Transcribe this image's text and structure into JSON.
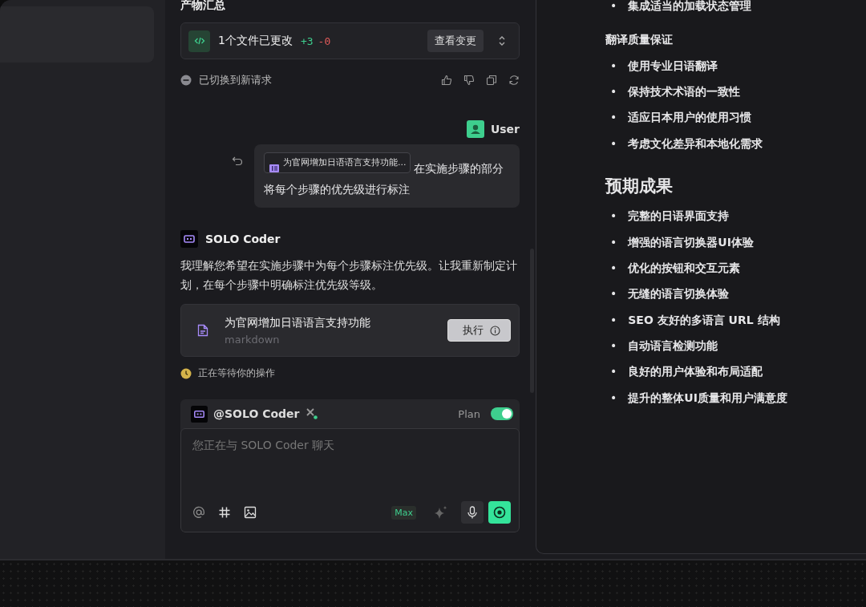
{
  "summary": {
    "heading": "产物汇总",
    "files_changed": "1个文件已更改",
    "added": "+3",
    "removed": "-0",
    "view_button": "查看变更"
  },
  "status_notice": "已切换到新请求",
  "user": {
    "name": "User",
    "reference_chip": "为官网增加日语语言支持功能...",
    "message": "在实施步骤的部分将每个步骤的优先级进行标注"
  },
  "agent": {
    "name": "SOLO Coder",
    "reply": "我理解您希望在实施步骤中为每个步骤标注优先级。让我重新制定计划，在每个步骤中明确标注优先级等级。",
    "plan_card": {
      "title": "为官网增加日语语言支持功能",
      "file_type": "markdown",
      "action": "执行"
    },
    "waiting": "正在等待你的操作"
  },
  "composer": {
    "mention": "@SOLO Coder",
    "plan_label": "Plan",
    "plan_on": true,
    "placeholder": "您正在与 SOLO Coder 聊天",
    "model_badge": "Max"
  },
  "document": {
    "bullet": "•",
    "leading_items": [
      "集成适当的加载状态管理"
    ],
    "sections": [
      {
        "kind": "subheading",
        "title": "翻译质量保证",
        "items": [
          "使用专业日语翻译",
          "保持技术术语的一致性",
          "适应日本用户的使用习惯",
          "考虑文化差异和本地化需求"
        ]
      },
      {
        "kind": "heading",
        "title": "预期成果",
        "items": [
          "完整的日语界面支持",
          "增强的语言切换器UI体验",
          "优化的按钮和交互元素",
          "无缝的语言切换体验",
          "SEO 友好的多语言 URL 结构",
          "自动语言检测功能",
          "良好的用户体验和布局适配",
          "提升的整体UI质量和用户满意度"
        ]
      }
    ]
  }
}
